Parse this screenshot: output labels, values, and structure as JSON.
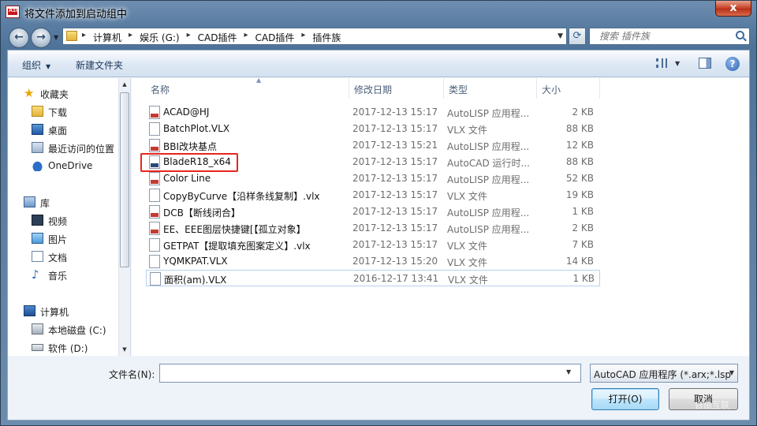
{
  "window": {
    "title": "将文件添加到启动组中",
    "app_icon_text": "A10",
    "close_label": "x"
  },
  "nav": {
    "back_label": "←",
    "forward_label": "→",
    "breadcrumb": [
      "计算机",
      "娱乐 (G:)",
      "CAD插件",
      "CAD插件",
      "插件族"
    ],
    "search_placeholder": "搜索 插件族"
  },
  "toolbar": {
    "organize_label": "组织",
    "new_folder_label": "新建文件夹",
    "help_label": "?"
  },
  "sidebar": {
    "items": [
      {
        "label": "收藏夹",
        "icon": "star-icon"
      },
      {
        "label": "下载",
        "icon": "download-folder-icon"
      },
      {
        "label": "桌面",
        "icon": "desktop-icon"
      },
      {
        "label": "最近访问的位置",
        "icon": "recent-places-icon"
      },
      {
        "label": "OneDrive",
        "icon": "onedrive-icon"
      },
      {
        "label": "库",
        "icon": "library-icon"
      },
      {
        "label": "视频",
        "icon": "video-icon"
      },
      {
        "label": "图片",
        "icon": "picture-icon"
      },
      {
        "label": "文档",
        "icon": "document-icon"
      },
      {
        "label": "音乐",
        "icon": "music-icon"
      },
      {
        "label": "计算机",
        "icon": "computer-icon"
      },
      {
        "label": "本地磁盘 (C:)",
        "icon": "local-disk-icon"
      },
      {
        "label": "软件 (D:)",
        "icon": "drive-icon"
      }
    ]
  },
  "columns": {
    "name": "名称",
    "date": "修改日期",
    "type": "类型",
    "size": "大小"
  },
  "files": [
    {
      "name": "ACAD@HJ",
      "date": "2017-12-13 15:17",
      "type": "AutoLISP 应用程...",
      "size": "2 KB",
      "icon": "lsp"
    },
    {
      "name": "BatchPlot.VLX",
      "date": "2017-12-13 15:17",
      "type": "VLX 文件",
      "size": "88 KB",
      "icon": "vlx"
    },
    {
      "name": "BBI改块基点",
      "date": "2017-12-13 15:21",
      "type": "AutoLISP 应用程...",
      "size": "12 KB",
      "icon": "lsp"
    },
    {
      "name": "BladeR18_x64",
      "date": "2017-12-13 15:17",
      "type": "AutoCAD 运行时...",
      "size": "88 KB",
      "icon": "arx"
    },
    {
      "name": "Color Line",
      "date": "2017-12-13 15:17",
      "type": "AutoLISP 应用程...",
      "size": "52 KB",
      "icon": "lsp"
    },
    {
      "name": "CopyByCurve【沿样条线复制】.vlx",
      "date": "2017-12-13 15:17",
      "type": "VLX 文件",
      "size": "19 KB",
      "icon": "vlx"
    },
    {
      "name": "DCB【断线闭合】",
      "date": "2017-12-13 15:17",
      "type": "AutoLISP 应用程...",
      "size": "1 KB",
      "icon": "lsp"
    },
    {
      "name": "EE、EEE图层快捷键[【孤立对象】",
      "date": "2017-12-13 15:17",
      "type": "AutoLISP 应用程...",
      "size": "2 KB",
      "icon": "lsp"
    },
    {
      "name": "GETPAT【提取填充图案定义】.vlx",
      "date": "2017-12-13 15:17",
      "type": "VLX 文件",
      "size": "7 KB",
      "icon": "vlx"
    },
    {
      "name": "YQMKPAT.VLX",
      "date": "2017-12-13 15:20",
      "type": "VLX 文件",
      "size": "14 KB",
      "icon": "vlx"
    },
    {
      "name": "面积(am).VLX",
      "date": "2016-12-17 13:41",
      "type": "VLX 文件",
      "size": "1 KB",
      "icon": "vlx"
    }
  ],
  "bottom": {
    "filename_label": "文件名(N):",
    "filename_value": "",
    "filetype_value": "AutoCAD 应用程序 (*.arx;*.lsp",
    "open_label": "打开(O)",
    "cancel_label": "取消"
  },
  "watermark": "自由互联"
}
